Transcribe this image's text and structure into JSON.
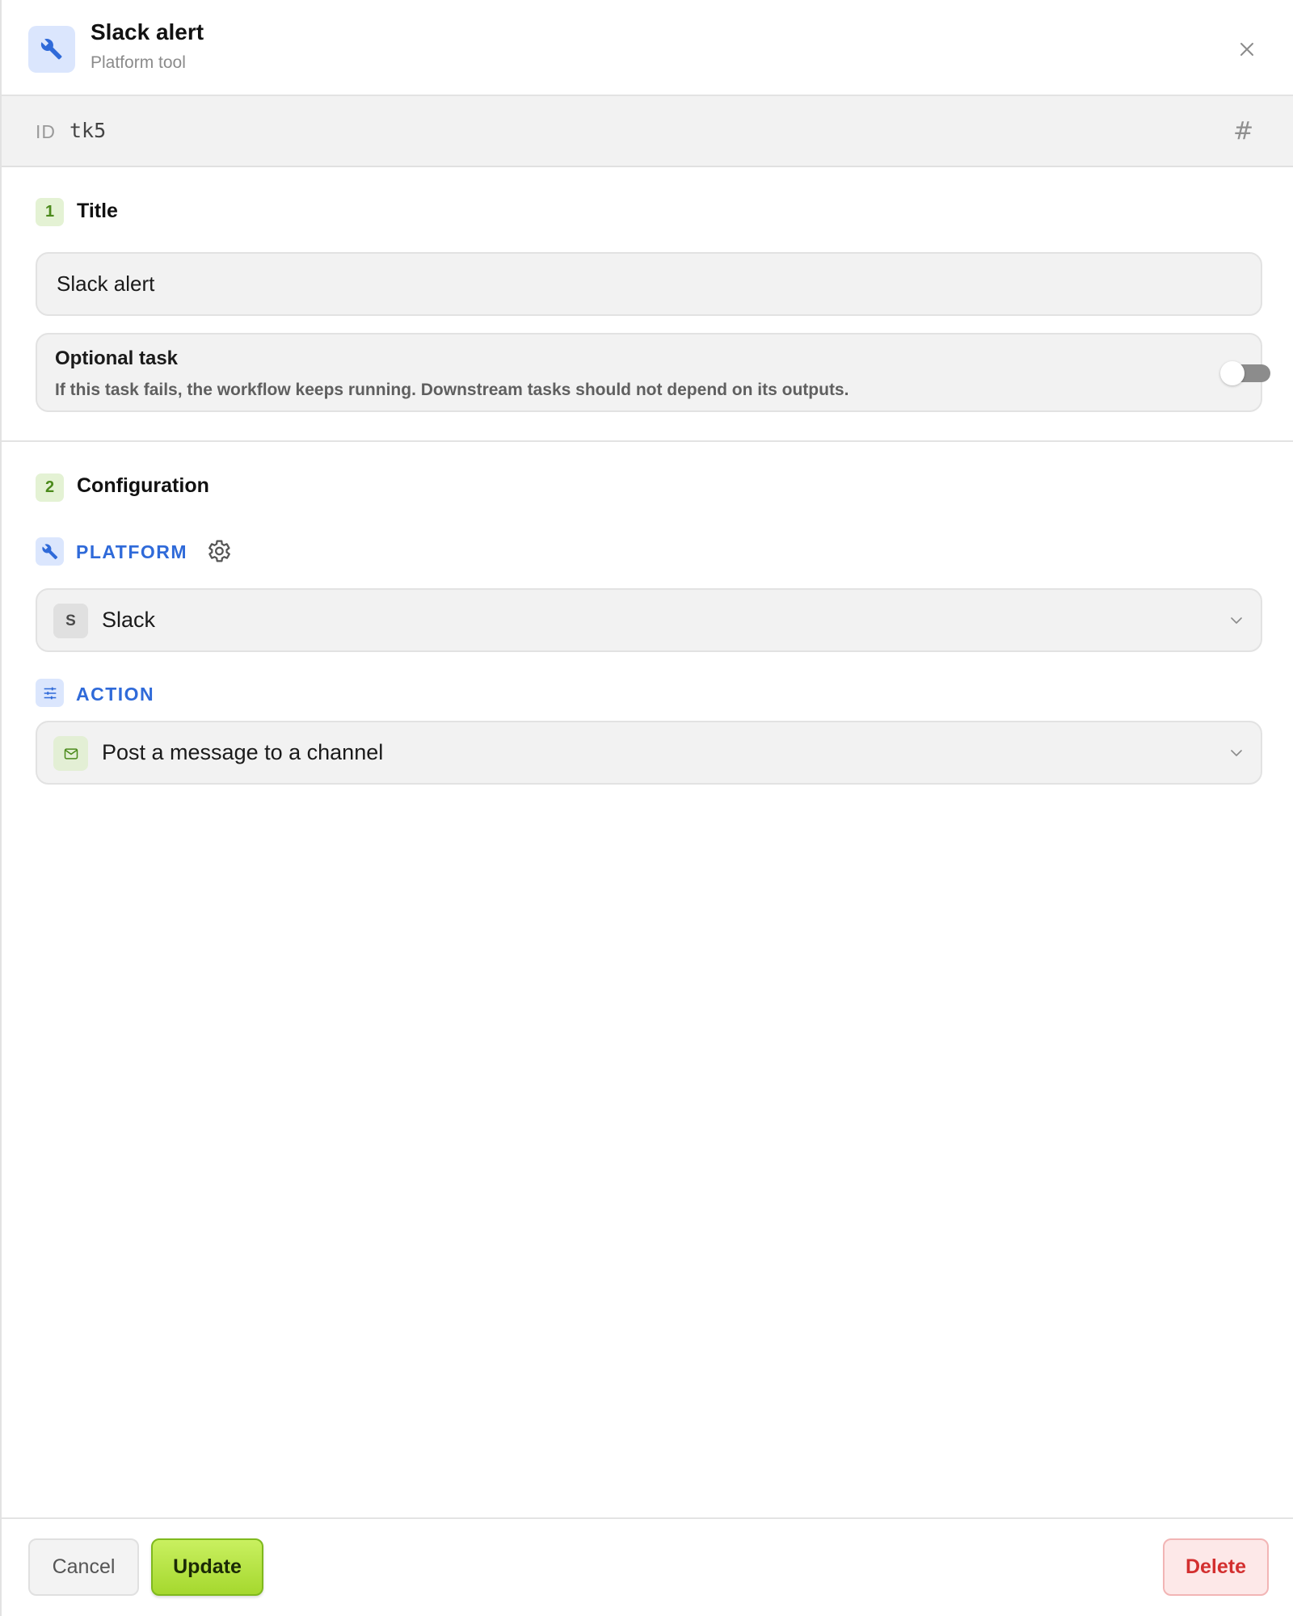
{
  "header": {
    "title": "Slack alert",
    "subtitle": "Platform tool",
    "icon": "wrench-icon"
  },
  "id_bar": {
    "label": "ID",
    "value": "tk5"
  },
  "sections": {
    "title": {
      "number": "1",
      "label": "Title",
      "input_value": "Slack alert",
      "optional": {
        "title": "Optional task",
        "description": "If this task fails, the workflow keeps running. Downstream tasks should not depend on its outputs.",
        "enabled": false
      }
    },
    "configuration": {
      "number": "2",
      "label": "Configuration",
      "platform": {
        "label": "PLATFORM",
        "badge": "S",
        "value": "Slack"
      },
      "action": {
        "label": "ACTION",
        "value": "Post a message to a channel"
      }
    }
  },
  "footer": {
    "cancel": "Cancel",
    "update": "Update",
    "delete": "Delete"
  },
  "colors": {
    "accent_blue": "#2f6ad9",
    "accent_green": "#a5d82e",
    "danger": "#d32f2f"
  }
}
